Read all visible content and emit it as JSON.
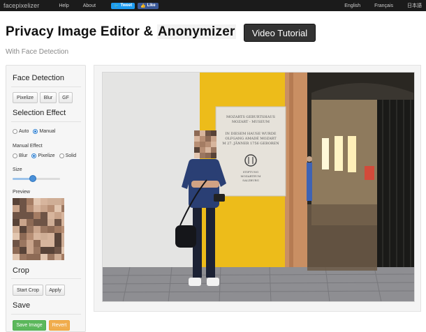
{
  "topbar": {
    "brand": "facepixelizer",
    "nav": [
      "Help",
      "About"
    ],
    "tweet_label": "Tweet",
    "like_label": "Like",
    "languages": [
      "English",
      "Français",
      "日本語"
    ]
  },
  "header": {
    "title_part1": "Privacy Image Editor & ",
    "title_part2": "Anonymizer",
    "video_button": "Video Tutorial",
    "subtitle": "With Face Detection"
  },
  "panel": {
    "face_detection_title": "Face Detection",
    "detect_buttons": [
      "Pixelize",
      "Blur",
      "GF"
    ],
    "selection_effect_title": "Selection Effect",
    "selection_options": [
      "Auto",
      "Manual"
    ],
    "selection_selected": "Manual",
    "manual_effect_label": "Manual Effect",
    "manual_options": [
      "Blur",
      "Pixelize",
      "Solid"
    ],
    "manual_selected": "Pixelize",
    "size_label": "Size",
    "size_value": 0.42,
    "preview_label": "Preview",
    "crop_title": "Crop",
    "start_crop_label": "Start Crop",
    "apply_label": "Apply",
    "save_title": "Save",
    "save_image_label": "Save Image",
    "revert_label": "Revert"
  },
  "photo": {
    "plaque_lines": [
      "MOZARTS GEBURTSHAUS",
      "MOZART - MUSEUM",
      "IN DIESEM HAUSE WURDE",
      "OLFGANG AMADÉ MOZART",
      "M 27. JÄNNER 1756 GEBOREN",
      "STIFTUNG",
      "MOZARTEUM",
      "SALZBURG"
    ]
  },
  "colors": {
    "topbar_bg": "#1b1b1b",
    "tweet_blue": "#1d9bf0",
    "like_blue": "#3b5998",
    "save_green": "#5cb85c",
    "revert_orange": "#f0ad4e",
    "wall_yellow": "#f1c21d"
  }
}
